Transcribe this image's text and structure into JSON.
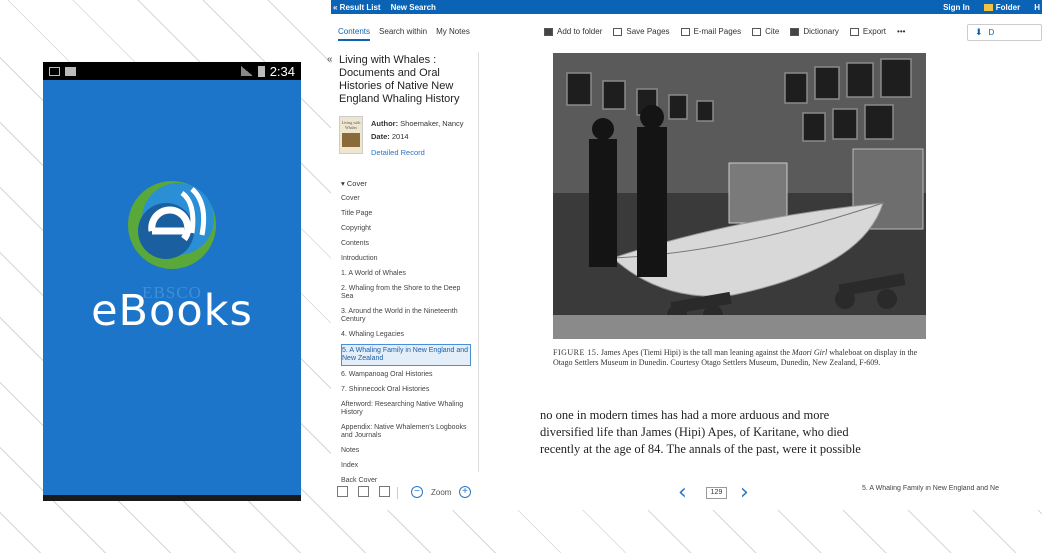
{
  "phone": {
    "status_time": "2:34",
    "brand_small": "EBSCO",
    "brand": "eBooks"
  },
  "topbar": {
    "result_list": "« Result List",
    "new_search": "New Search",
    "sign_in": "Sign In",
    "folder": "Folder",
    "help": "H"
  },
  "tabs": [
    "Contents",
    "Search within",
    "My Notes"
  ],
  "toolbar": {
    "add_to_folder": "Add to folder",
    "save_pages": "Save Pages",
    "email_pages": "E-mail Pages",
    "cite": "Cite",
    "dictionary": "Dictionary",
    "export": "Export",
    "more": "•••",
    "download": "D"
  },
  "book": {
    "title": "Living with Whales : Documents and Oral Histories of Native New England Whaling History",
    "thumb_text": "Living with Whales",
    "author_label": "Author:",
    "author": "Shoemaker, Nancy",
    "date_label": "Date:",
    "date": "2014",
    "detailed_record": "Detailed Record"
  },
  "toc": {
    "head": "Cover",
    "items": [
      "Cover",
      "Title Page",
      "Copyright",
      "Contents",
      "Introduction",
      "1. A World of Whales",
      "2. Whaling from the Shore to the Deep Sea",
      "3. Around the World in the Nineteenth Century",
      "4. Whaling Legacies",
      "5. A Whaling Family in New England and New Zealand",
      "6. Wampanoag Oral Histories",
      "7. Shinnecock Oral Histories",
      "Afterword: Researching Native Whaling History",
      "Appendix: Native Whalemen's Logbooks and Journals",
      "Notes",
      "Index",
      "Back Cover"
    ],
    "active_index": 9
  },
  "viewer": {
    "caption_label": "FIGURE 15.",
    "caption_a": "James Apes (Tiemi Hipi) is the tall man leaning against the",
    "caption_em": "Maori Girl",
    "caption_b": "whaleboat on display in the Otago Settlers Museum in Dunedin. Courtesy Otago Settlers Museum, Dunedin, New Zealand, F-609.",
    "body_lines": [
      "no one in modern times has had a more arduous and more",
      "diversified life than James (Hipi) Apes, of Karitane, who died",
      "recently at the age of 84. The annals of the past, were it possible"
    ]
  },
  "bottom": {
    "zoom": "Zoom",
    "page": "129",
    "chapter": "5. A Whaling Family in New England and Ne"
  },
  "colors": {
    "accent": "#0b63b5",
    "phone_bg": "#1c75c8"
  }
}
